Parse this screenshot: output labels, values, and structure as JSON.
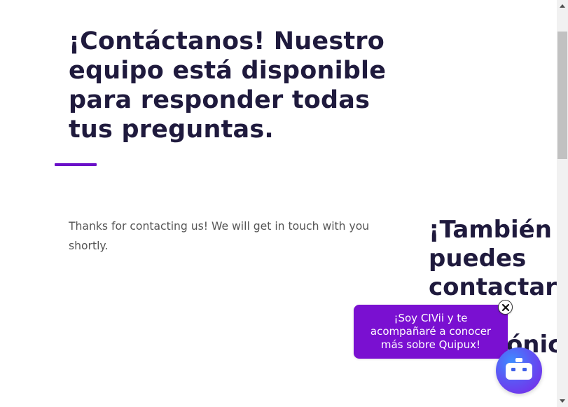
{
  "main": {
    "title": "¡Contáctanos! Nuestro equipo está disponible para responder todas tus preguntas.",
    "message": "Thanks for contacting us! We will get in touch with you shortly.",
    "side_heading": {
      "line1": "¡También",
      "line2": "puedes",
      "line3": "contactarn",
      "line4": "electrónico"
    }
  },
  "chat": {
    "bubble_text": "¡Soy CIVii y te acompañaré a conocer más sobre Quipux!",
    "close_icon": "close-icon",
    "launcher_icon": "robot-icon"
  },
  "colors": {
    "heading": "#1f1a3d",
    "body": "#555555",
    "accent": "#6a10c8",
    "bubble": "#7a10d1"
  }
}
